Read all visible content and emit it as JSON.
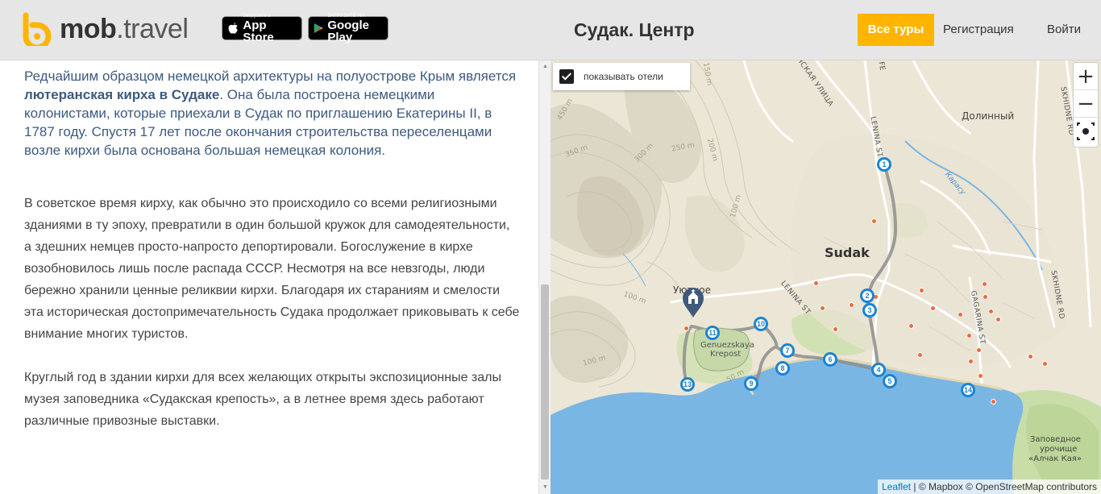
{
  "header": {
    "logo_mob": "mob",
    "logo_dot": ".",
    "logo_travel": "travel",
    "appstore_small": "Загрузите в",
    "appstore_big": "App Store",
    "googleplay_small": "ЗАГРУЗИТЕ НА",
    "googleplay_big": "Google Play",
    "title": "Судак. Центр",
    "tours_button": "Все туры",
    "register": "Регистрация",
    "login": "Войти"
  },
  "article": {
    "lead_part1": "Редчайшим образцом немецкой архитектуры на полуострове Крым является ",
    "lead_bold": "лютеранская кирха в Судаке",
    "lead_part2": ". Она была построена немецкими колонистами, которые приехали в Судак по приглашению Екатерины II, в 1787 году. Спустя 17 лет после окончания строительства переселенцами возле кирхи была основана большая немецкая колония.",
    "paragraph1": "В советское время кирху, как обычно это происходило со всеми религиозными зданиями в ту эпоху, превратили в один большой кружок для самодеятельности, а здешних немцев просто-напросто депортировали. Богослужение в кирхе возобновилось лишь после распада СССР. Несмотря на все невзгоды, люди бережно хранили ценные реликвии кирхи. Благодаря их стараниям и смелости эта историческая достопримечательность Судака продолжает приковывать к себе внимание многих туристов.",
    "paragraph2": "Круглый год в здании кирхи для всех желающих открыты экспозиционные залы музея заповедника «Судакская крепость», а в летнее время здесь работают различные привозные выставки."
  },
  "map": {
    "show_hotels_label": "показывать отели",
    "show_hotels_checked": true,
    "zoom_in": "+",
    "zoom_out": "−",
    "attribution_leaflet": "Leaflet",
    "attribution_rest": " | © Mapbox © OpenStreetMap contributors",
    "labels": {
      "sudak": "Sudak",
      "dolinny": "Долинный",
      "lenina_st": "LENINA ST",
      "lenina_st2": "LENINA ST",
      "skhidne_rd": "SKHIDNE RD",
      "skhidne_rd2": "SKHIDNE RD",
      "gagarina_st": "GAGARINA ST",
      "genuezskaya": "Genuezskaya",
      "krepost": "Krepost",
      "uyutnoe": "Уютное",
      "ulitsa": "ЯСКАЯ УЛИЦА",
      "karasu": "Карасу",
      "fe": "FE",
      "zapovednoe1": "Заповедное",
      "zapovednoe2": "урочище",
      "zapovednoe3": "«Алчак Кая»",
      "c150": "150 m",
      "c450": "450 m",
      "c350": "350 m",
      "c300": "300 m",
      "c250": "250 m",
      "c200": "200 m",
      "c100": "100 m",
      "c50": "50 m",
      "c100b": "100 m",
      "c100c": "100 m"
    },
    "markers": [
      "1",
      "2",
      "3",
      "4",
      "5",
      "6",
      "7",
      "8",
      "9",
      "10",
      "11",
      "13",
      "14"
    ]
  },
  "colors": {
    "accent": "#ffb500",
    "lead_text": "#3d5a80",
    "marker": "#1c84d1",
    "sea": "#7ab6e3",
    "hotel_dot": "#f06a3a"
  }
}
